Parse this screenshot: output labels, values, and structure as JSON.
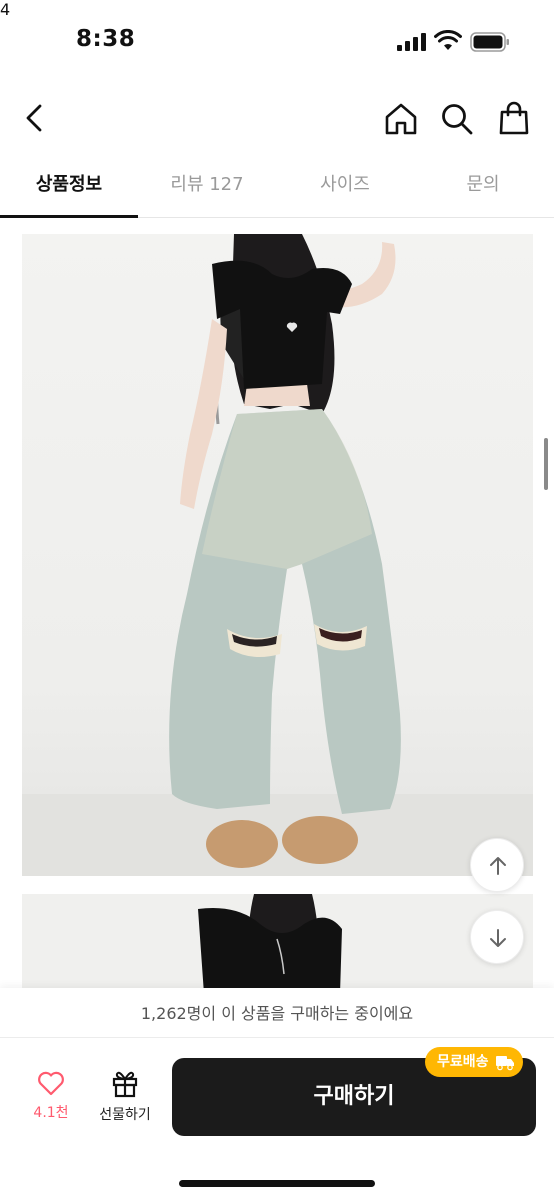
{
  "status_bar": {
    "time": "8:38"
  },
  "header": {
    "cart_count": "4"
  },
  "tabs": [
    {
      "label": "상품정보",
      "active": true
    },
    {
      "label": "리뷰 127",
      "active": false
    },
    {
      "label": "사이즈",
      "active": false
    },
    {
      "label": "문의",
      "active": false
    }
  ],
  "bottom_bar": {
    "purchase_notice": "1,262명이 이 상품을 구매하는 중이에요",
    "like_count": "4.1천",
    "gift_label": "선물하기",
    "buy_label": "구매하기",
    "free_shipping_badge": "무료배송"
  },
  "colors": {
    "accent": "#ff5a6e",
    "badge": "#ffb703",
    "buy_button": "#1b1b1b"
  },
  "icons": [
    "back-icon",
    "home-icon",
    "search-icon",
    "cart-icon",
    "scroll-up-icon",
    "scroll-down-icon",
    "heart-icon",
    "gift-icon",
    "truck-icon"
  ]
}
